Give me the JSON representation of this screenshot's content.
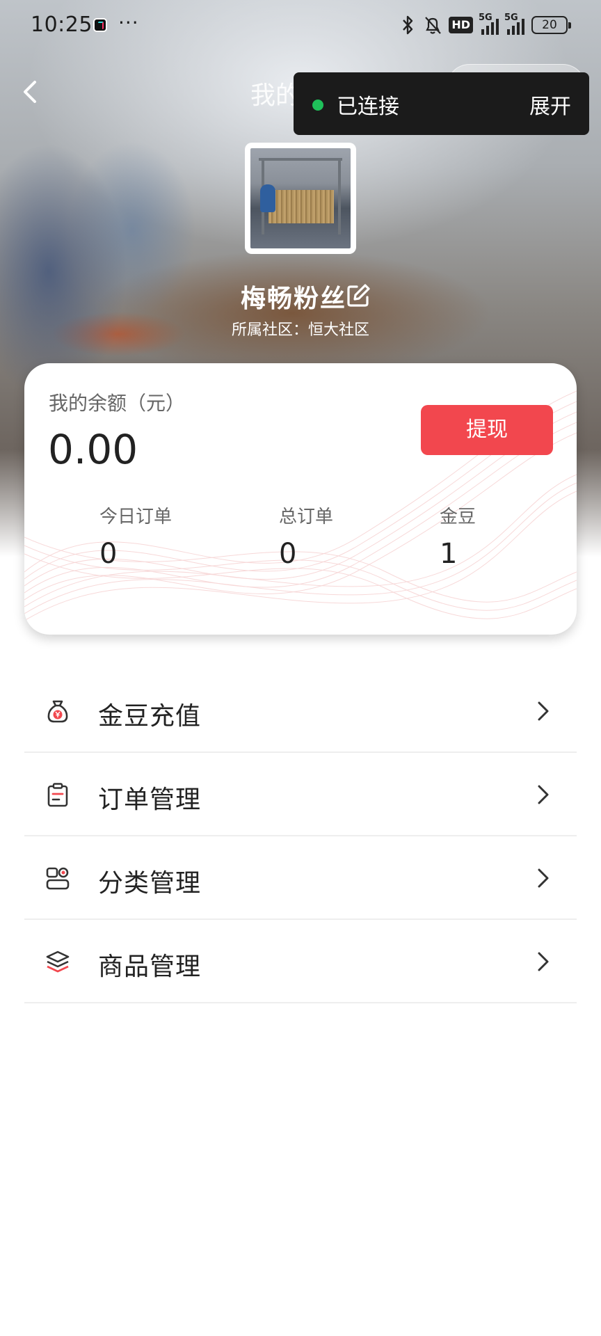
{
  "status_bar": {
    "time": "10:25",
    "more": "···",
    "network_badge": "HD",
    "signal_1": "5G",
    "signal_2": "5G",
    "battery": "20"
  },
  "nav": {
    "title": "我的",
    "back_icon": "chevron-left-icon",
    "capsule_more_icon": "more-dots-icon",
    "capsule_close_icon": "target-icon"
  },
  "connection_toast": {
    "status": "已连接",
    "action": "展开",
    "indicator_color": "#1fc05a"
  },
  "profile": {
    "store_name": "梅畅粉丝",
    "community_label": "所属社区：",
    "community_name": "恒大社区",
    "edit_icon": "edit-icon"
  },
  "balance_card": {
    "label": "我的余额（元）",
    "balance": "0.00",
    "withdraw_label": "提现",
    "accent_color": "#f2474e",
    "stats": [
      {
        "label": "今日订单",
        "value": "0"
      },
      {
        "label": "总订单",
        "value": "0"
      },
      {
        "label": "金豆",
        "value": "1"
      }
    ]
  },
  "menu": {
    "items": [
      {
        "label": "金豆充值",
        "icon": "money-bag-icon"
      },
      {
        "label": "订单管理",
        "icon": "clipboard-icon"
      },
      {
        "label": "分类管理",
        "icon": "category-icon"
      },
      {
        "label": "商品管理",
        "icon": "layers-icon"
      }
    ]
  }
}
